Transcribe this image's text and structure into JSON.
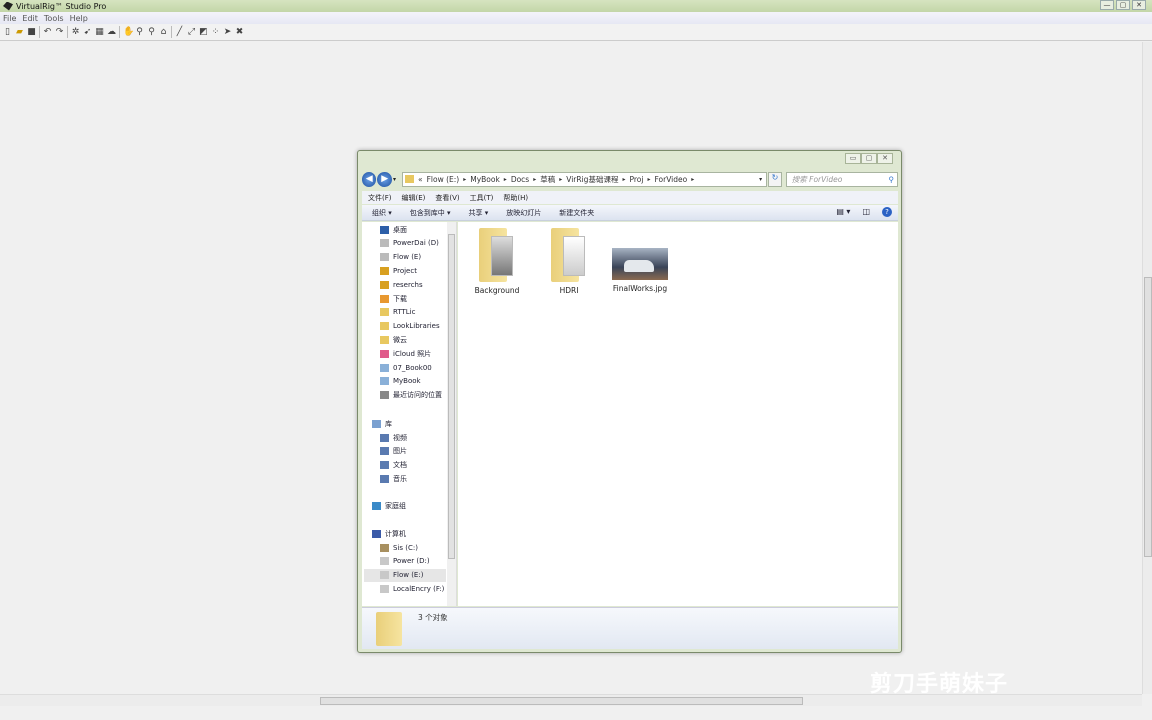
{
  "app": {
    "title": "VirtualRig™ Studio Pro",
    "menu": [
      "File",
      "Edit",
      "Tools",
      "Help"
    ],
    "toolbar_icons": [
      "new-icon",
      "open-icon",
      "save-icon",
      "undo-icon",
      "redo-icon",
      "rig-icon",
      "bone-icon",
      "layer-icon",
      "bake-icon",
      "hand-icon",
      "pin-icon",
      "pin2-icon",
      "lock-icon",
      "line-icon",
      "scale-icon",
      "box-icon",
      "dots-icon",
      "arrow-icon",
      "close-icon"
    ],
    "window_controls": [
      "—",
      "▢",
      "✕"
    ],
    "watermark": "剪刀手萌妹子"
  },
  "explorer": {
    "window_controls": [
      "▭",
      "▢",
      "✕"
    ],
    "address": {
      "prefix": "«",
      "crumbs": [
        "Flow (E:)",
        "MyBook",
        "Docs",
        "草稿",
        "VirRig基础课程",
        "Proj",
        "ForVideo"
      ]
    },
    "search_placeholder": "搜索 ForVideo",
    "menu": [
      "文件(F)",
      "编辑(E)",
      "查看(V)",
      "工具(T)",
      "帮助(H)"
    ],
    "commands": [
      "组织 ▾",
      "包含到库中 ▾",
      "共享 ▾",
      "放映幻灯片",
      "新建文件夹"
    ],
    "nav": [
      {
        "label": "桌面",
        "icon": "desktop-icon",
        "color": "#2d5fa8"
      },
      {
        "label": "PowerDai (D)",
        "icon": "drive-icon",
        "color": "#bbbbbb"
      },
      {
        "label": "Flow (E)",
        "icon": "drive-icon",
        "color": "#bbbbbb"
      },
      {
        "label": "Project",
        "icon": "lock-folder-icon",
        "color": "#d8a020"
      },
      {
        "label": "reserchs",
        "icon": "lock-folder-icon",
        "color": "#d8a020"
      },
      {
        "label": "下载",
        "icon": "download-icon",
        "color": "#e89830"
      },
      {
        "label": "RTTLic",
        "icon": "folder-icon",
        "color": "#e8c860"
      },
      {
        "label": "LookLibraries",
        "icon": "folder-icon",
        "color": "#e8c860"
      },
      {
        "label": "微云",
        "icon": "folder-icon",
        "color": "#e8c860"
      },
      {
        "label": "iCloud 照片",
        "icon": "icloud-photos-icon",
        "color": "#e05a8a"
      },
      {
        "label": "07_Book00",
        "icon": "cloud-icon",
        "color": "#8ab0d8"
      },
      {
        "label": "MyBook",
        "icon": "cloud-icon",
        "color": "#8ab0d8"
      },
      {
        "label": "最近访问的位置",
        "icon": "recent-icon",
        "color": "#888888"
      }
    ],
    "libraries": {
      "label": "库",
      "items": [
        {
          "label": "视频",
          "icon": "video-icon"
        },
        {
          "label": "图片",
          "icon": "pictures-icon"
        },
        {
          "label": "文档",
          "icon": "documents-icon"
        },
        {
          "label": "音乐",
          "icon": "music-icon"
        }
      ]
    },
    "homegroup": "家庭组",
    "computer": {
      "label": "计算机",
      "items": [
        "Sis (C:)",
        "Power (D:)",
        "Flow (E:)",
        "LocalEncry (F:)"
      ],
      "selected": "Flow (E:)"
    },
    "files": [
      {
        "name": "Background",
        "type": "folder"
      },
      {
        "name": "HDRI",
        "type": "folder"
      },
      {
        "name": "FinalWorks.jpg",
        "type": "image"
      }
    ],
    "status": "3 个对象"
  }
}
